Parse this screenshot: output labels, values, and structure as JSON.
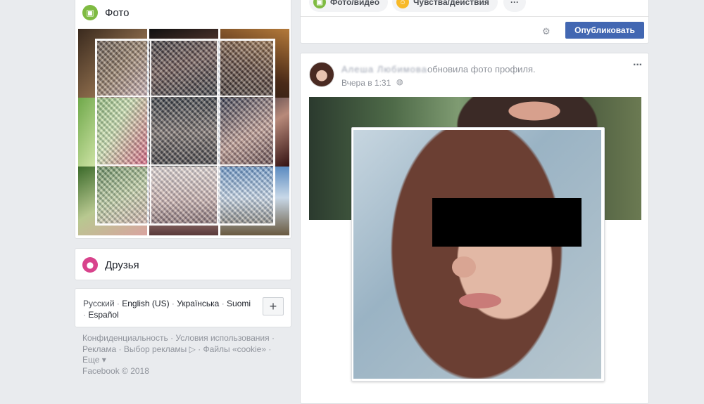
{
  "photos": {
    "title": "Фото"
  },
  "friends": {
    "title": "Друзья"
  },
  "languages": {
    "items": [
      "Русский",
      "English (US)",
      "Українська",
      "Suomi",
      "Español"
    ],
    "separator": "·",
    "add_label": "+"
  },
  "footer": {
    "links": [
      "Конфиденциальность",
      "Условия использования",
      "Реклама",
      "Выбор рекламы",
      "Файлы «cookie»",
      "Еще"
    ],
    "copyright": "Facebook © 2018"
  },
  "composer": {
    "photo_video": "Фото/видео",
    "feelings": "Чувства/действия",
    "more": "···",
    "publish": "Опубликовать"
  },
  "post": {
    "author": "Алеша Любимова",
    "action": "обновила фото профиля.",
    "time": "Вчера в 1:31",
    "more": "···"
  },
  "colors": {
    "brand": "#4267b2",
    "photo_icon": "#7fbb42",
    "friends_icon": "#d8438c",
    "feelings_icon": "#f7b928"
  },
  "icons": {
    "photo": "photo-icon",
    "friends": "friends-icon",
    "feelings": "smile-icon",
    "gear": "gear-icon",
    "globe": "globe-icon"
  }
}
